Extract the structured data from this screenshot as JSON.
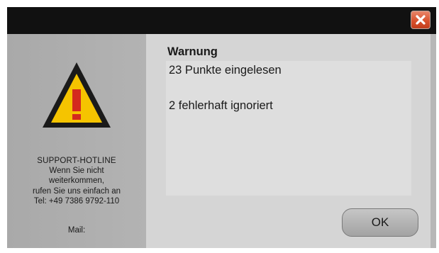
{
  "window": {
    "close_icon": "close-icon"
  },
  "sidebar": {
    "icon": "warning-icon",
    "hotline": {
      "title": "SUPPORT-HOTLINE",
      "line1": "Wenn Sie nicht",
      "line2": "weiterkommen,",
      "line3": "rufen Sie uns einfach an",
      "phone": "Tel: +49 7386 9792-110",
      "mail": "Mail:"
    }
  },
  "main": {
    "heading": "Warnung",
    "messages": [
      "23 Punkte eingelesen",
      "2 fehlerhaft ignoriert"
    ],
    "ok_label": "OK"
  },
  "colors": {
    "titlebar": "#111111",
    "close_button": "#d9532f",
    "warning_yellow": "#f5c400",
    "warning_border": "#1a1a1a",
    "exclamation": "#d42a1e",
    "sidebar": "#aeaeae",
    "content": "#d5d5d5"
  }
}
